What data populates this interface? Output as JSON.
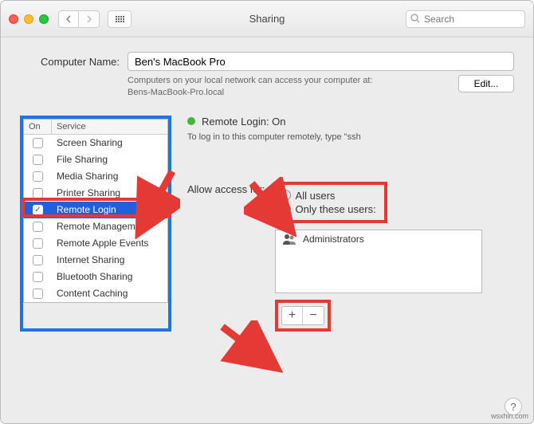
{
  "window": {
    "title": "Sharing"
  },
  "search": {
    "placeholder": "Search"
  },
  "computerName": {
    "label": "Computer Name:",
    "value": "Ben's MacBook Pro",
    "description1": "Computers on your local network can access your computer at:",
    "description2": "Bens-MacBook-Pro.local",
    "editLabel": "Edit..."
  },
  "serviceTable": {
    "col1": "On",
    "col2": "Service",
    "rows": [
      {
        "on": false,
        "name": "Screen Sharing"
      },
      {
        "on": false,
        "name": "File Sharing"
      },
      {
        "on": false,
        "name": "Media Sharing"
      },
      {
        "on": false,
        "name": "Printer Sharing"
      },
      {
        "on": true,
        "name": "Remote Login"
      },
      {
        "on": false,
        "name": "Remote Management"
      },
      {
        "on": false,
        "name": "Remote Apple Events"
      },
      {
        "on": false,
        "name": "Internet Sharing"
      },
      {
        "on": false,
        "name": "Bluetooth Sharing"
      },
      {
        "on": false,
        "name": "Content Caching"
      }
    ]
  },
  "status": {
    "title": "Remote Login: On",
    "subtitle": "To log in to this computer remotely, type \"ssh"
  },
  "access": {
    "label": "Allow access for:",
    "opt1": "All users",
    "opt2": "Only these users:"
  },
  "users": {
    "row1": "Administrators"
  },
  "annotations": {
    "colors": {
      "highlight_red": "#e53935",
      "highlight_blue": "#1e73e8"
    }
  },
  "watermark": "wsxhin.com"
}
